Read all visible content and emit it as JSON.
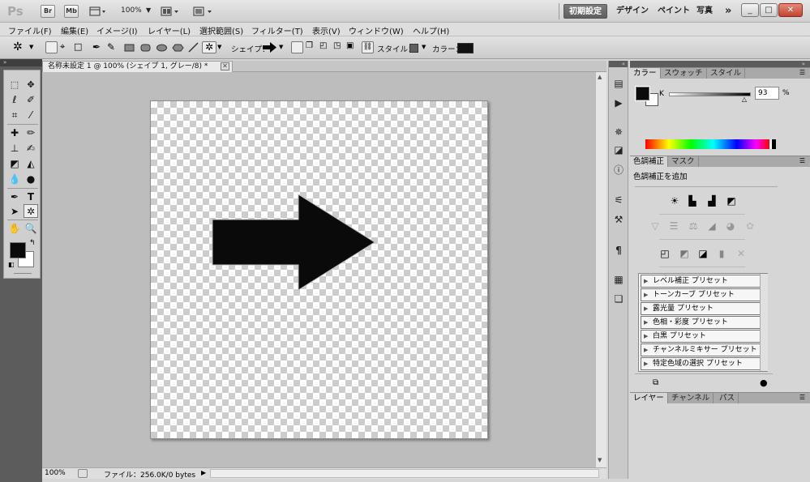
{
  "titlebar": {
    "app_logo": "Ps",
    "bridge_label": "Br",
    "minibridge_label": "Mb",
    "zoom": "100%",
    "workspaces": [
      "初期設定",
      "デザイン",
      "ペイント",
      "写真"
    ],
    "more": "»",
    "window_buttons": [
      "_",
      "□",
      "✕"
    ]
  },
  "menu": [
    "ファイル(F)",
    "編集(E)",
    "イメージ(I)",
    "レイヤー(L)",
    "選択範囲(S)",
    "フィルター(T)",
    "表示(V)",
    "ウィンドウ(W)",
    "ヘルプ(H)"
  ],
  "options": {
    "shape_label": "シェイプ：",
    "style_label": "スタイル：",
    "color_label": "カラー：",
    "color_value": "#111111"
  },
  "document": {
    "tab_title": "名称未設定 1 @ 100% (シェイプ 1, グレー/8) *",
    "close": "✕"
  },
  "status": {
    "zoom": "100%",
    "file_info": "ファイル：256.0K/0 bytes"
  },
  "color_panel": {
    "tabs": [
      "カラー",
      "スウォッチ",
      "スタイル"
    ],
    "channel": "K",
    "value": "93",
    "unit": "%",
    "slider_fraction": 0.93
  },
  "adjust_panel": {
    "tabs": [
      "色調補正",
      "マスク"
    ],
    "heading": "色調補正を追加",
    "presets": [
      "レベル補正 プリセット",
      "トーンカーブ プリセット",
      "露光量 プリセット",
      "色相・彩度 プリセット",
      "白黒 プリセット",
      "チャンネルミキサー プリセット",
      "特定色域の選択 プリセット"
    ]
  },
  "layers_panel": {
    "tabs": [
      "レイヤー",
      "チャンネル",
      "パス"
    ]
  },
  "colors": {
    "foreground": "#0a0a0a",
    "background": "#ffffff",
    "accent": "#5e5e5e"
  }
}
